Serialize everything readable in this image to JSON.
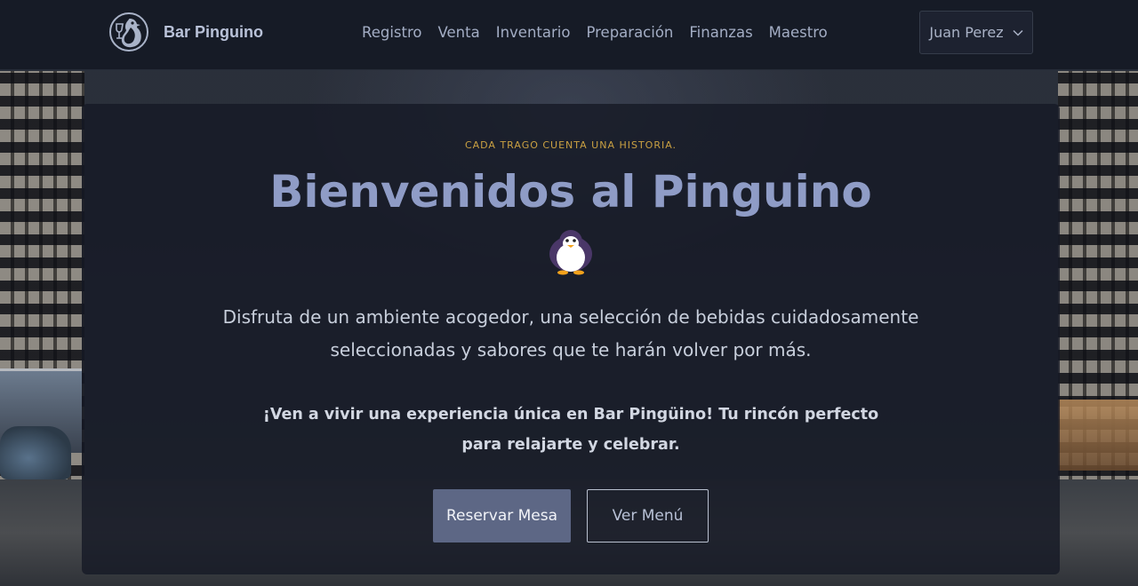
{
  "brand": {
    "name": "Bar Pinguino"
  },
  "nav": {
    "items": [
      {
        "label": "Registro"
      },
      {
        "label": "Venta"
      },
      {
        "label": "Inventario"
      },
      {
        "label": "Preparación"
      },
      {
        "label": "Finanzas"
      },
      {
        "label": "Maestro"
      }
    ]
  },
  "user": {
    "name": "Juan Perez",
    "icon": "chevron-down-icon"
  },
  "hero": {
    "eyebrow": "CADA TRAGO CUENTA UNA HISTORIA.",
    "title": "Bienvenidos al Pinguino",
    "emoji": "penguin-icon",
    "lead": "Disfruta de un ambiente acogedor, una selección de bebidas cuidadosamente seleccionadas y sabores que te harán volver por más.",
    "invite": "¡Ven a vivir una experiencia única en Bar Pingüino! Tu rincón perfecto para relajarte y celebrar.",
    "primary_button": "Reservar Mesa",
    "secondary_button": "Ver Menú"
  },
  "colors": {
    "navbar": "#161b26",
    "title": "#8f9cc6",
    "eyebrow": "#c9a042",
    "primary_button": "#5d6785"
  }
}
